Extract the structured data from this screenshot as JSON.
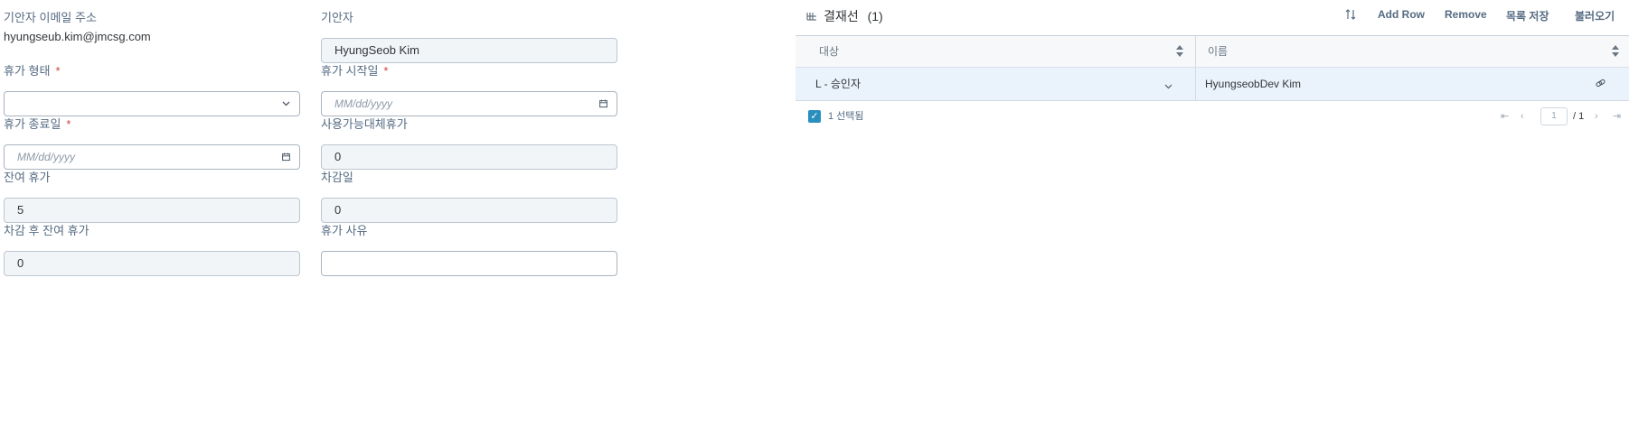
{
  "form": {
    "requester_email": {
      "label": "기안자 이메일 주소",
      "value": "hyungseub.kim@jmcsg.com"
    },
    "requester": {
      "label": "기안자",
      "value": "HyungSeob Kim"
    },
    "leave_type": {
      "label": "휴가 형태",
      "required_mark": "*",
      "value": ""
    },
    "leave_start": {
      "label": "휴가 시작일",
      "required_mark": "*",
      "placeholder": "MM/dd/yyyy"
    },
    "leave_end": {
      "label": "휴가 종료일",
      "required_mark": "*",
      "placeholder": "MM/dd/yyyy"
    },
    "available_substitute_leave": {
      "label": "사용가능대체휴가",
      "value": "0"
    },
    "remaining_leave": {
      "label": "잔여 휴가",
      "value": "5"
    },
    "deduction_days": {
      "label": "차감일",
      "value": "0"
    },
    "remaining_after_deduction": {
      "label": "차감 후 잔여 휴가",
      "value": "0"
    },
    "leave_reason": {
      "label": "휴가 사유",
      "value": ""
    }
  },
  "approval_panel": {
    "title": "결재선",
    "count": "(1)",
    "toolbar": {
      "add_row": "Add Row",
      "remove": "Remove",
      "save_list": "목록 저장",
      "load": "불러오기"
    },
    "columns": [
      "대상",
      "이름"
    ],
    "rows": [
      {
        "target": "L - 승인자",
        "name": "HyungseobDev Kim"
      }
    ],
    "footer": {
      "selected_count": "1 선택됨",
      "page_input": "1",
      "page_total": "/ 1"
    }
  },
  "icons": {
    "dropdown": "chevron-down-icon",
    "calendar": "calendar-icon",
    "sort": "sort-icon",
    "link": "link-icon",
    "table": "table-icon"
  },
  "colors": {
    "label": "#556b82",
    "required": "#d04343",
    "readonly_bg": "#f2f5f8",
    "selected_row_bg": "#eaf3fb",
    "checkbox": "#2a8fbd"
  }
}
